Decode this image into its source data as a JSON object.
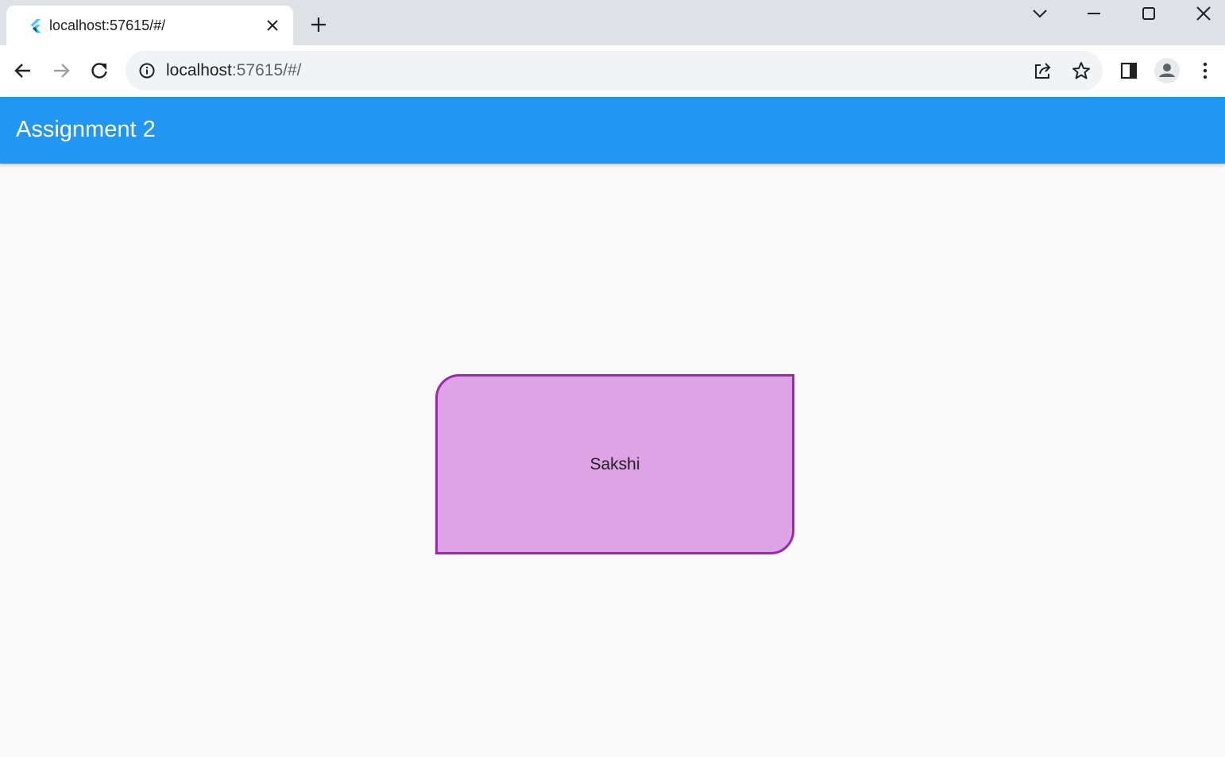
{
  "browser": {
    "tab": {
      "title": "localhost:57615/#/"
    },
    "address_bar": {
      "host": "localhost",
      "path": ":57615/#/"
    }
  },
  "app": {
    "title": "Assignment 2",
    "accent_color": "#2196f3"
  },
  "card": {
    "label": "Sakshi",
    "fill_color": "#dda3e5",
    "border_color": "#9c27b0"
  }
}
